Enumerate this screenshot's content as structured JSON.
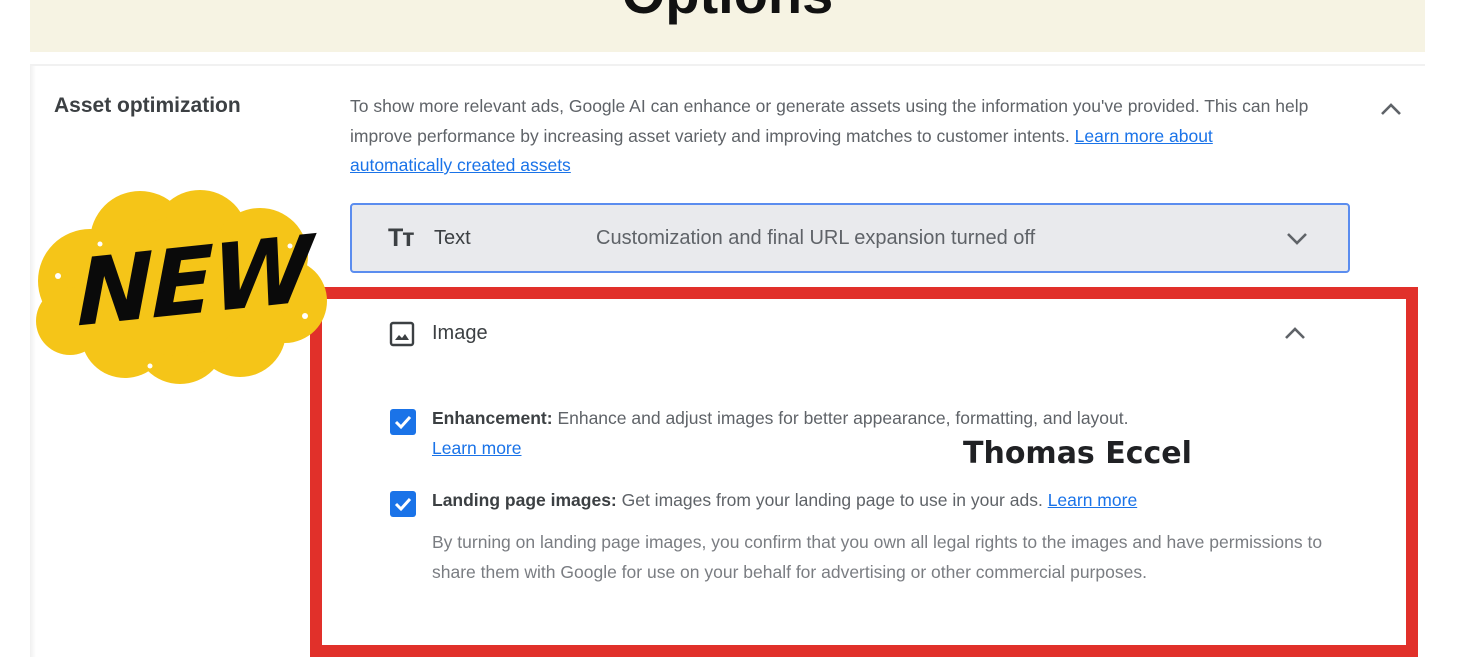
{
  "banner": {
    "title": "Options"
  },
  "asset_optimization": {
    "label": "Asset optimization",
    "description": "To show more relevant ads, Google AI can enhance or generate assets using the information you've provided. This can help improve performance by increasing asset variety and improving matches to customer intents.",
    "learn_more_link": "Learn more about automatically created assets"
  },
  "text_row": {
    "icon_glyph": "Tт",
    "label": "Text",
    "status": "Customization and final URL expansion turned off"
  },
  "image_panel": {
    "label": "Image",
    "enhancement": {
      "title": "Enhancement:",
      "description": " Enhance and adjust images for better appearance, formatting, and layout.",
      "learn_more": "Learn more",
      "checked": true
    },
    "landing_page_images": {
      "title": "Landing page images:",
      "description": " Get images from your landing page to use in your ads. ",
      "learn_more": "Learn more",
      "checked": true,
      "legal": "By turning on landing page images, you confirm that you own all legal rights to the images and have permissions to share them with Google for use on your behalf for advertising or other commercial purposes."
    }
  },
  "overlay": {
    "sticker_text": "NEW",
    "watermark": "Thomas Eccel"
  },
  "colors": {
    "accent": "#1a73e8",
    "highlight_box": "#e1302a",
    "sticker": "#f5c518",
    "banner": "#f6f3e3"
  },
  "icons": {
    "collapse": "chevron-up-icon",
    "expand": "chevron-down-icon",
    "image": "image-icon",
    "text": "text-format-icon",
    "checkbox": "checkbox-checked-icon"
  }
}
